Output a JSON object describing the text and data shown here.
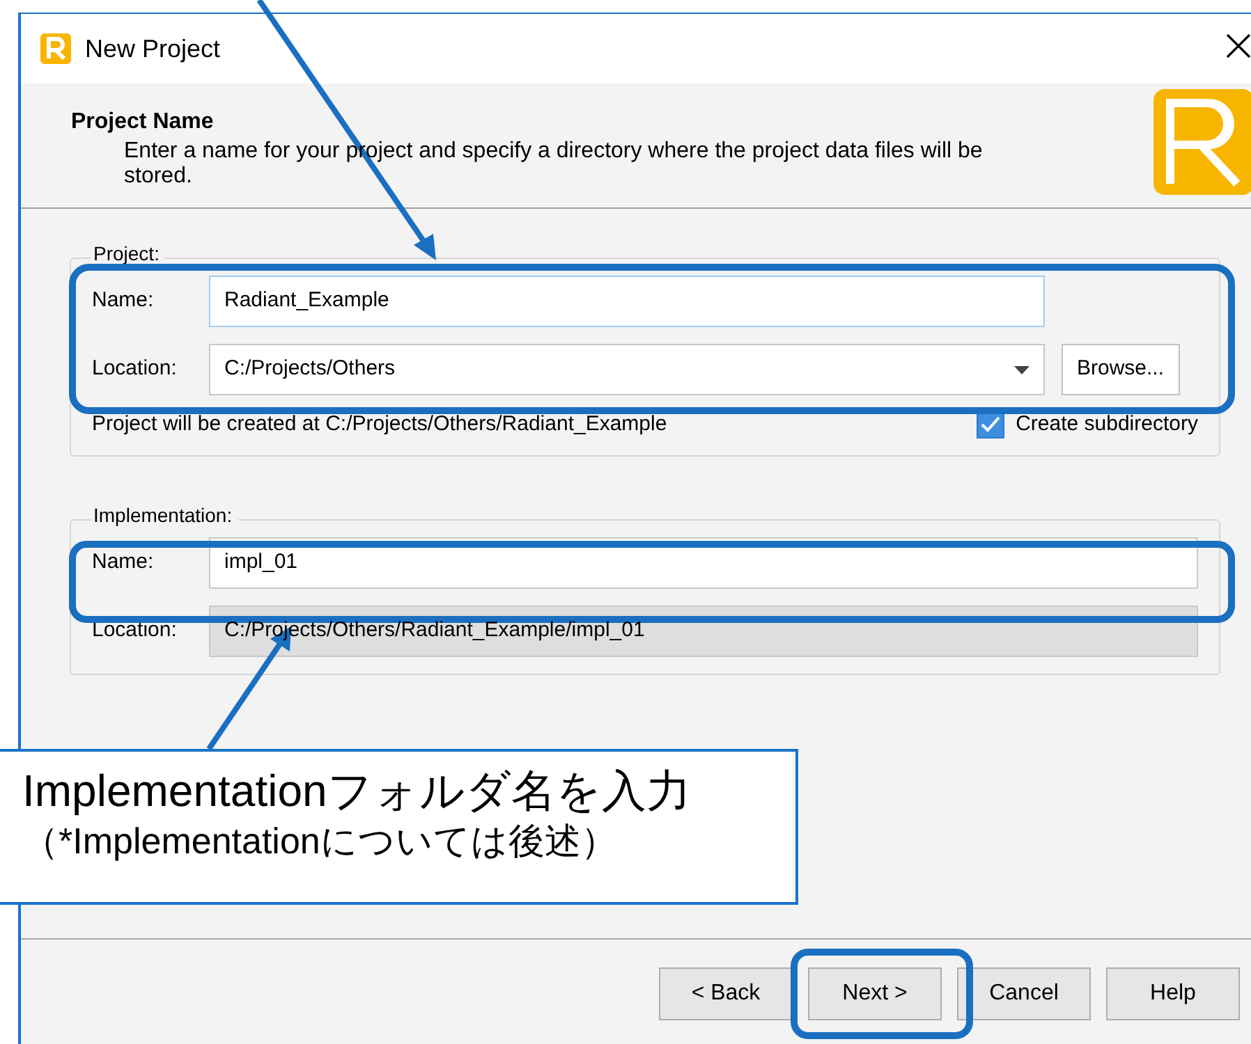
{
  "window": {
    "title": "New Project"
  },
  "header": {
    "title": "Project Name",
    "description": "Enter a name for your project and specify a directory where the project data files will be stored."
  },
  "project_group": {
    "legend": "Project:",
    "name": {
      "label": "Name:",
      "value": "Radiant_Example"
    },
    "location": {
      "label": "Location:",
      "value": "C:/Projects/Others"
    },
    "browse_button": "Browse...",
    "note": "Project will be created at C:/Projects/Others/Radiant_Example",
    "create_subdirectory": {
      "label": "Create subdirectory",
      "checked": true
    }
  },
  "implementation_group": {
    "legend": "Implementation:",
    "name": {
      "label": "Name:",
      "value": "impl_01"
    },
    "location": {
      "label": "Location:",
      "value": "C:/Projects/Others/Radiant_Example/impl_01",
      "disabled": true
    }
  },
  "buttons": [
    {
      "label": "< Back"
    },
    {
      "label": "Next >"
    },
    {
      "label": "Cancel"
    },
    {
      "label": "Help"
    }
  ],
  "callout": {
    "lines": [
      "Implementationフォルダ名を入力",
      "（*Implementationについては後述）"
    ]
  }
}
